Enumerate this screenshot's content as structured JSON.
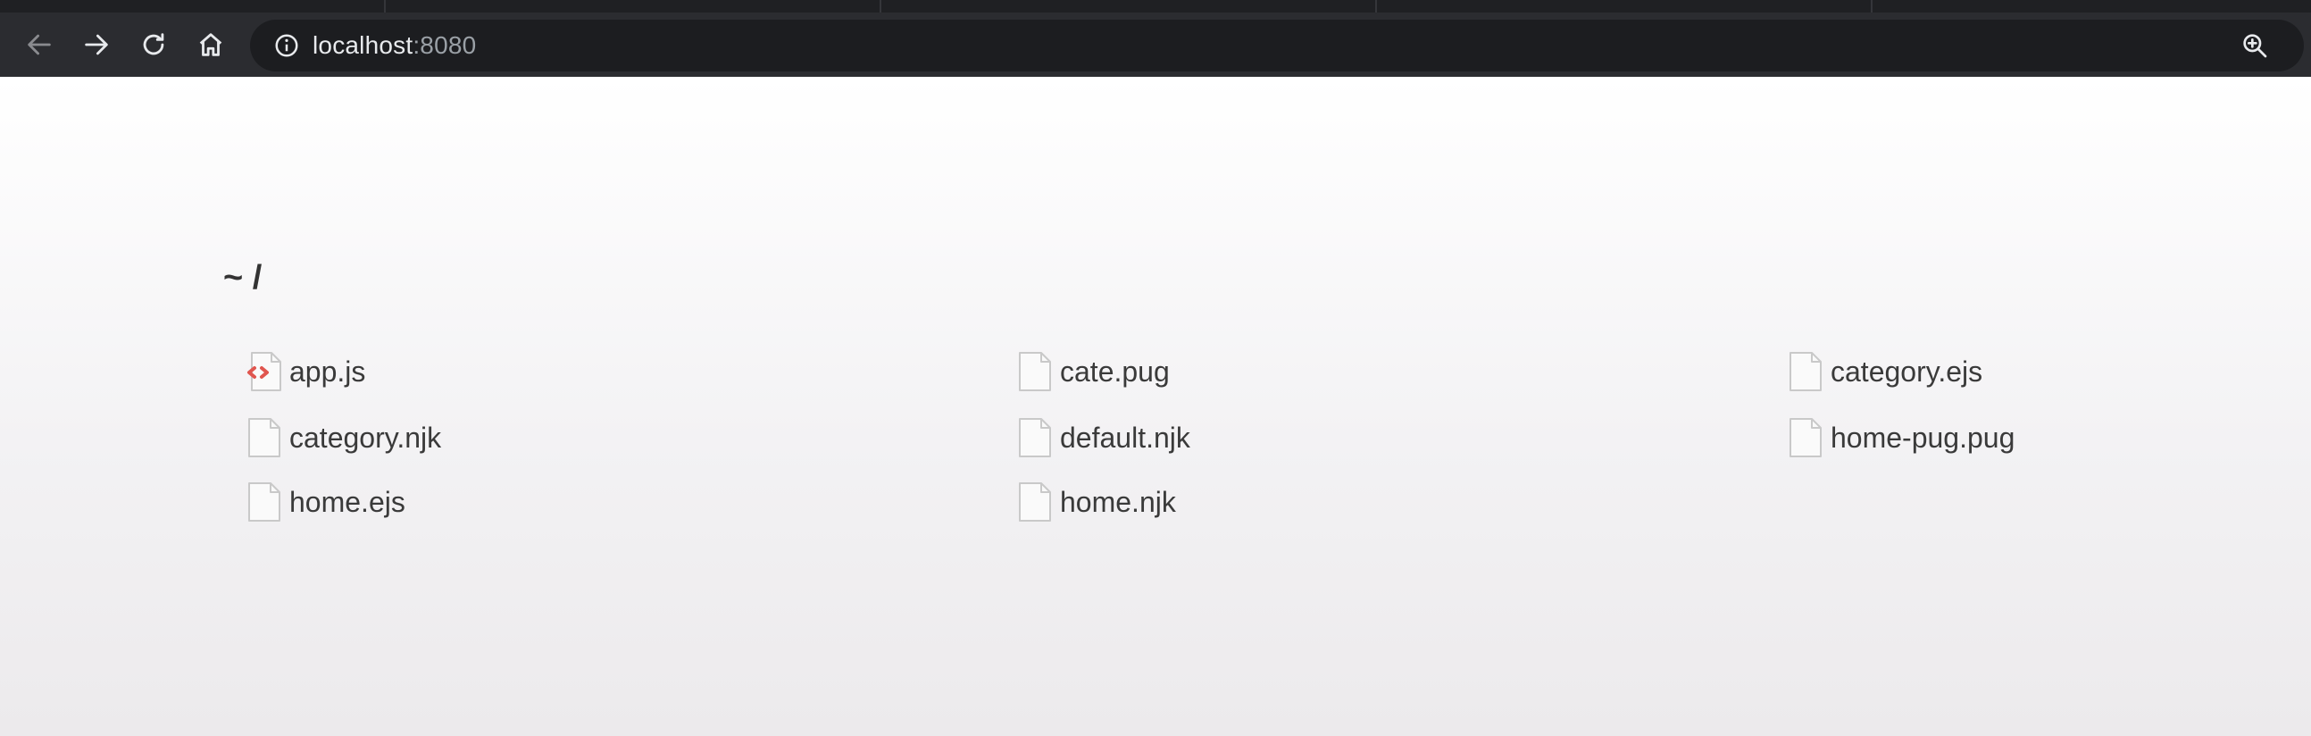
{
  "browser": {
    "address": {
      "host": "localhost",
      "port": ":8080"
    },
    "buttons": {
      "back": "back-icon",
      "forward": "forward-icon",
      "reload": "reload-icon",
      "home": "home-icon",
      "site_info": "info-icon",
      "zoom": "zoom-in-icon"
    }
  },
  "page": {
    "breadcrumb": "~ /",
    "files": [
      {
        "name": "app.js",
        "icon": "js-file-icon"
      },
      {
        "name": "cate.pug",
        "icon": "file-icon"
      },
      {
        "name": "category.ejs",
        "icon": "file-icon"
      },
      {
        "name": "category.njk",
        "icon": "file-icon"
      },
      {
        "name": "default.njk",
        "icon": "file-icon"
      },
      {
        "name": "home-pug.pug",
        "icon": "file-icon"
      },
      {
        "name": "home.ejs",
        "icon": "file-icon"
      },
      {
        "name": "home.njk",
        "icon": "file-icon"
      }
    ]
  },
  "colors": {
    "chrome_bg": "#2b2c30",
    "omnibox_bg": "#1c1d20",
    "js_accent": "#e0564f",
    "text": "#3a3a3a"
  }
}
